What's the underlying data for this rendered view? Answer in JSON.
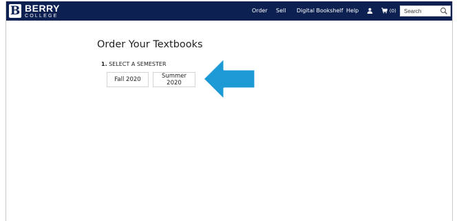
{
  "header": {
    "logo": {
      "letter": "B",
      "name": "BERRY",
      "sub": "COLLEGE"
    },
    "nav": [
      "Order",
      "Sell",
      "Digital Bookshelf",
      "Help"
    ],
    "cart_count": "(0)",
    "search_placeholder": "Search",
    "bg_color": "#0c2152"
  },
  "main": {
    "title": "Order Your Textbooks",
    "step_number": "1.",
    "step_label": "SELECT A SEMESTER",
    "semesters": [
      "Fall 2020",
      "Summer 2020"
    ]
  },
  "annotation": {
    "arrow_color": "#1b9ad6",
    "arrow_direction": "left"
  }
}
